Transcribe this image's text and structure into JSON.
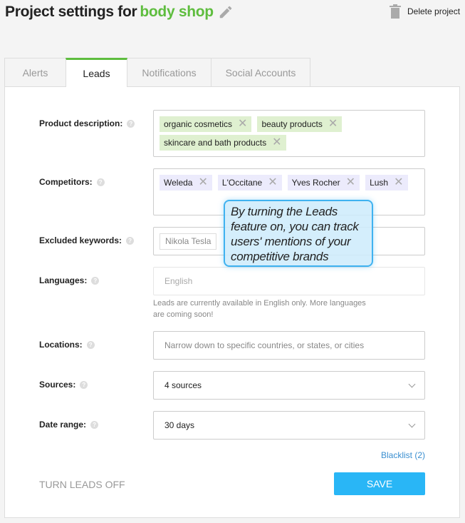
{
  "header": {
    "title": "Project settings for",
    "project": "body shop",
    "delete": "Delete project"
  },
  "tabs": [
    {
      "label": "Alerts"
    },
    {
      "label": "Leads",
      "active": true
    },
    {
      "label": "Notifications"
    },
    {
      "label": "Social Accounts"
    }
  ],
  "form": {
    "product": {
      "label": "Product description:",
      "chips": [
        "organic cosmetics",
        "beauty products",
        "skincare and bath products"
      ]
    },
    "competitors": {
      "label": "Competitors:",
      "chips": [
        "Weleda",
        "L'Occitane",
        "Yves Rocher",
        "Lush"
      ]
    },
    "excluded": {
      "label": "Excluded keywords:",
      "chips": [
        "Nikola Tesla"
      ]
    },
    "languages": {
      "label": "Languages:",
      "value": "English",
      "note": "Leads are currently available in English only. More languages are coming soon!"
    },
    "locations": {
      "label": "Locations:",
      "placeholder": "Narrow down to specific countries, or states, or cities"
    },
    "sources": {
      "label": "Sources:",
      "value": "4 sources"
    },
    "date": {
      "label": "Date range:",
      "value": "30 days"
    },
    "blacklist": "Blacklist (2)",
    "turn_off": "TURN LEADS OFF",
    "save": "SAVE"
  },
  "tooltip": "By turning the Leads feature on, you can track users' mentions of your competitive brands",
  "colors": {
    "accent": "#5ebd3e",
    "button": "#29b6f6",
    "tooltip_border": "#3fb2f0"
  }
}
